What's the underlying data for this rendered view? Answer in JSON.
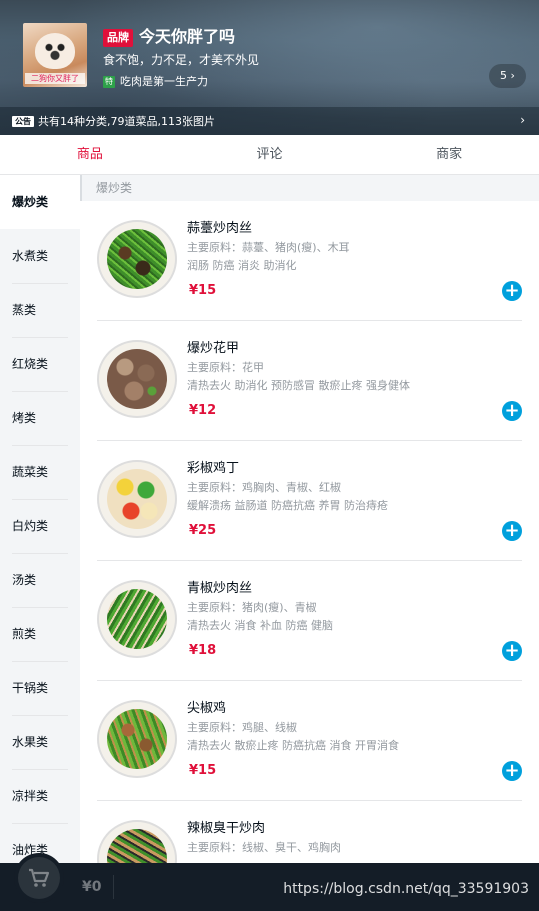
{
  "header": {
    "avatar_caption": "二狗你又胖了",
    "brand_badge": "品牌",
    "shop_name": "今天你胖了吗",
    "description": "食不饱，力不足，才美不外见",
    "support_tag": "特",
    "support_text": "吃肉是第一生产力",
    "support_count": "5 ›",
    "bulletin_label": "公告",
    "bulletin_text": "共有14种分类,79道菜品,113张图片",
    "bulletin_arrow": "›"
  },
  "tabs": [
    {
      "label": "商品",
      "active": true
    },
    {
      "label": "评论",
      "active": false
    },
    {
      "label": "商家",
      "active": false
    }
  ],
  "menu": [
    {
      "label": "爆炒类",
      "active": true
    },
    {
      "label": "水煮类"
    },
    {
      "label": "蒸类"
    },
    {
      "label": "红烧类"
    },
    {
      "label": "烤类"
    },
    {
      "label": "蔬菜类"
    },
    {
      "label": "白灼类"
    },
    {
      "label": "汤类"
    },
    {
      "label": "煎类"
    },
    {
      "label": "干锅类"
    },
    {
      "label": "水果类"
    },
    {
      "label": "凉拌类"
    },
    {
      "label": "油炸类"
    }
  ],
  "category_title": "爆炒类",
  "foods": [
    {
      "name": "蒜薹炒肉丝",
      "ingredients": "主要原料：蒜薹、猪肉(瘦)、木耳",
      "tags": "润肠 防癌 消炎 助消化",
      "price": "¥15"
    },
    {
      "name": "爆炒花甲",
      "ingredients": "主要原料：花甲",
      "tags": "清热去火 助消化 预防感冒 散瘀止疼 强身健体",
      "price": "¥12"
    },
    {
      "name": "彩椒鸡丁",
      "ingredients": "主要原料：鸡胸肉、青椒、红椒",
      "tags": "缓解溃疡 益肠道 防癌抗癌 养胃 防治痔疮",
      "price": "¥25"
    },
    {
      "name": "青椒炒肉丝",
      "ingredients": "主要原料：猪肉(瘦)、青椒",
      "tags": "清热去火 消食 补血 防癌 健脑",
      "price": "¥18"
    },
    {
      "name": "尖椒鸡",
      "ingredients": "主要原料：鸡腿、线椒",
      "tags": "清热去火 散瘀止疼 防癌抗癌 消食 开胃消食",
      "price": "¥15"
    },
    {
      "name": "辣椒臭干炒肉",
      "ingredients": "主要原料：线椒、臭干、鸡胸肉",
      "tags": "",
      "price": ""
    }
  ],
  "cart": {
    "price": "¥0",
    "watermark": "https://blog.csdn.net/qq_33591903"
  },
  "colors": {
    "accent": "#e0103a",
    "add_button": "#00a0dc",
    "cart_bg": "#141d27"
  },
  "icons": {
    "cart": "shopping-cart-icon",
    "add": "plus-circle-icon"
  }
}
